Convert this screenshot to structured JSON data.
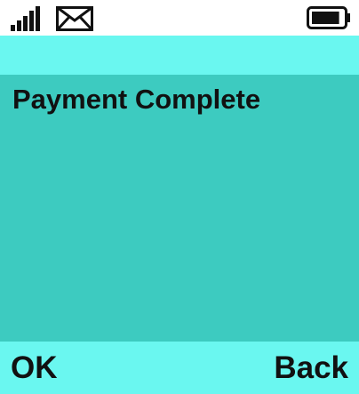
{
  "status_bar": {
    "signal_icon": "signal-bars-icon",
    "message_icon": "envelope-icon",
    "battery_icon": "battery-icon",
    "battery_level": 0.9
  },
  "content": {
    "message": "Payment Complete"
  },
  "softkeys": {
    "left_label": "OK",
    "right_label": "Back"
  },
  "colors": {
    "header_strip": "#6af7f0",
    "content_bg": "#3dcbc0",
    "text": "#111111"
  }
}
